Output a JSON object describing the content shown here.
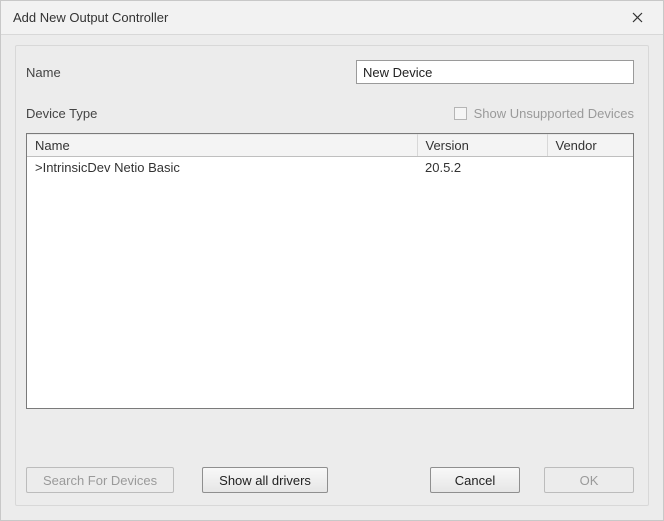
{
  "dialog": {
    "title": "Add New Output Controller"
  },
  "fields": {
    "name_label": "Name",
    "name_value": "New Device",
    "device_type_label": "Device Type",
    "show_unsupported_label": "Show Unsupported Devices",
    "show_unsupported_checked": false,
    "show_unsupported_enabled": false
  },
  "table": {
    "columns": {
      "name": "Name",
      "version": "Version",
      "vendor": "Vendor"
    },
    "rows": [
      {
        "name": ">IntrinsicDev Netio Basic",
        "version": "20.5.2",
        "vendor": ""
      }
    ]
  },
  "buttons": {
    "search": "Search For Devices",
    "show_all": "Show all drivers",
    "cancel": "Cancel",
    "ok": "OK"
  }
}
